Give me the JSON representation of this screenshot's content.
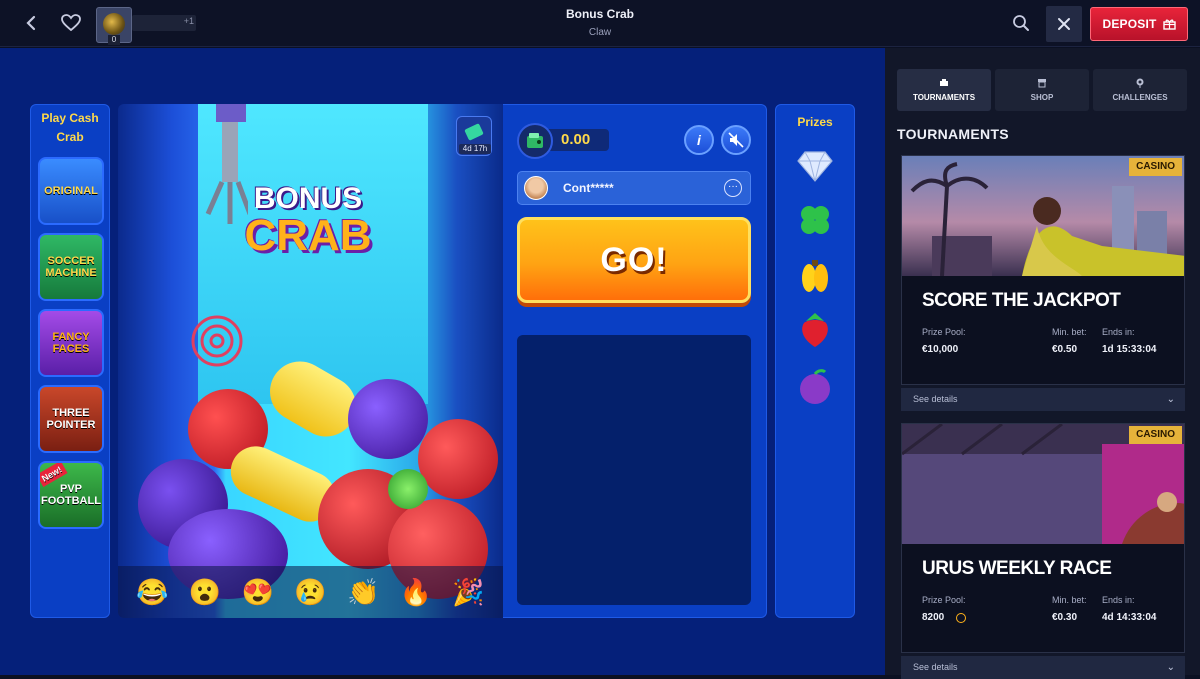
{
  "header": {
    "title": "Bonus Crab",
    "subtitle": "Claw",
    "avatar_count": "0",
    "xp_plus": "+1",
    "deposit_label": "DEPOSIT"
  },
  "game": {
    "left_title_line1": "Play Cash",
    "left_title_line2": "Crab",
    "games": [
      {
        "name": "ORIGINAL"
      },
      {
        "name": "SOCCER MACHINE"
      },
      {
        "name": "FANCY FACES"
      },
      {
        "name": "THREE POINTER"
      },
      {
        "name": "PVP FOOTBALL",
        "badge": "New!"
      }
    ],
    "logo_line1": "BONUS",
    "logo_line2": "CRAB",
    "timer": "4d 17h",
    "balance": "0.00",
    "info_label": "i",
    "player_name": "Cont*****",
    "player_more": "···",
    "go_label": "GO!",
    "emojis": [
      "😂",
      "😮",
      "😍",
      "😢",
      "👏",
      "🔥",
      "🎉"
    ],
    "prizes_title": "Prizes",
    "prizes": [
      "diamond",
      "clover",
      "banana",
      "strawberry",
      "plum"
    ]
  },
  "sidebar": {
    "tabs": [
      {
        "label": "TOURNAMENTS",
        "icon": "trophy-icon"
      },
      {
        "label": "SHOP",
        "icon": "shop-icon"
      },
      {
        "label": "CHALLENGES",
        "icon": "target-icon"
      }
    ],
    "section_title": "TOURNAMENTS",
    "tournaments": [
      {
        "badge": "CASINO",
        "title": "SCORE THE JACKPOT",
        "prize_pool_label": "Prize Pool:",
        "prize_pool": "€10,000",
        "min_bet_label": "Min. bet:",
        "min_bet": "€0.50",
        "ends_label": "Ends in:",
        "ends": "1d 15:33:04",
        "details": "See details"
      },
      {
        "badge": "CASINO",
        "title": "URUS WEEKLY RACE",
        "prize_pool_label": "Prize Pool:",
        "prize_pool": "8200",
        "min_bet_label": "Min. bet:",
        "min_bet": "€0.30",
        "ends_label": "Ends in:",
        "ends": "4d 14:33:04",
        "details": "See details"
      }
    ]
  },
  "colors": {
    "game_bg": "#05207a",
    "panel": "#0a3fc4",
    "accent_yellow": "#ffd94a",
    "deposit_red": "#d8182f",
    "sidebar_bg": "#121729"
  }
}
